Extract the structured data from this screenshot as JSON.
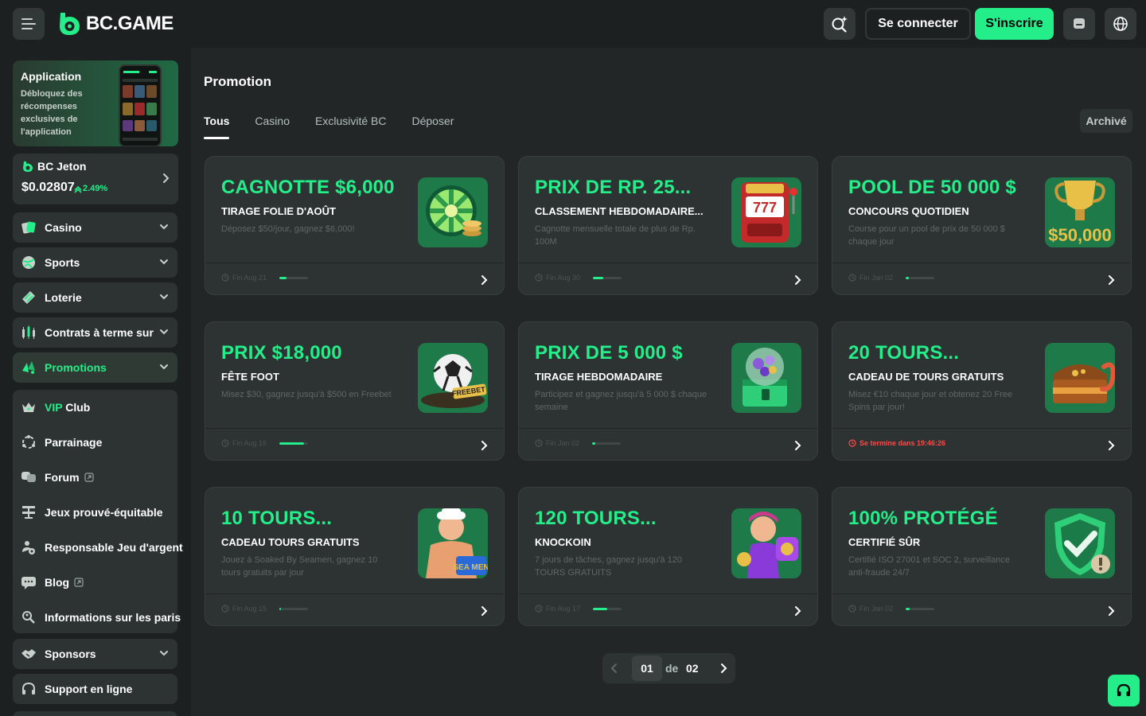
{
  "header": {
    "logo_text": "BC.GAME",
    "login_label": "Se connecter",
    "register_label": "S'inscrire",
    "accent_color": "#24ee89"
  },
  "sidebar": {
    "app_card": {
      "title": "Application",
      "description": "Débloquez des récompenses exclusives de l'application"
    },
    "jeton": {
      "label": "BC Jeton",
      "price": "$0.02807",
      "change": "2.49%"
    },
    "items": [
      {
        "label": "Casino",
        "icon": "casino-icon"
      },
      {
        "label": "Sports",
        "icon": "sports-icon"
      },
      {
        "label": "Loterie",
        "icon": "lottery-icon"
      },
      {
        "label": "Contrats à terme sur",
        "icon": "futures-icon"
      },
      {
        "label": "Promotions",
        "icon": "promotions-icon"
      }
    ],
    "group_items": [
      {
        "label_prefix": "VIP",
        "label": "Club",
        "icon": "vip-crown-icon"
      },
      {
        "label": "Parrainage",
        "icon": "referral-icon"
      },
      {
        "label": "Forum",
        "icon": "forum-icon"
      },
      {
        "label": "Jeux prouvé-équitable",
        "icon": "provably-fair-icon"
      },
      {
        "label": "Responsable Jeu d'argent",
        "icon": "responsible-gambling-icon"
      },
      {
        "label": "Blog",
        "icon": "blog-icon"
      },
      {
        "label": "Informations sur les paris",
        "icon": "bet-info-icon"
      }
    ],
    "sponsors_label": "Sponsors",
    "support_label": "Support en ligne"
  },
  "main": {
    "title": "Promotion",
    "tabs": [
      "Tous",
      "Casino",
      "Exclusivité BC",
      "Déposer"
    ],
    "archive_label": "Archivé",
    "promos": [
      {
        "title": "CAGNOTTE $6,000",
        "subtitle": "TIRAGE FOLIE D'AOÛT",
        "desc": "Déposez $50/jour, gagnez $6,000!",
        "footer": "Fin Aug 21",
        "progress": 0.25,
        "image": "jackpot-wheel"
      },
      {
        "title": "PRIX DE RP. 25...",
        "subtitle": "CLASSEMENT HEBDOMADAIRE...",
        "desc": "Cagnotte mensuelle totale de plus de Rp. 100M",
        "footer": "Fin Aug 30",
        "progress": 0.35,
        "image": "slot-machine"
      },
      {
        "title": "POOL DE 50 000 $",
        "subtitle": "CONCOURS QUOTIDIEN",
        "desc": "Course pour un pool de prix de 50 000 $ chaque jour",
        "footer": "Fin Jan 02",
        "progress": 0.1,
        "image": "trophy-50000"
      },
      {
        "title": "PRIX $18,000",
        "subtitle": "FÊTE FOOT",
        "desc": "Misez $30, gagnez jusqu'à $500 en Freebet",
        "footer": "Fin Aug 16",
        "progress": 0.85,
        "image": "football-freebet"
      },
      {
        "title": "PRIX DE 5 000 $",
        "subtitle": "TIRAGE HEBDOMADAIRE",
        "desc": "Participez et gagnez jusqu'à 5 000 $ chaque semaine",
        "footer": "Fin Jan 02",
        "progress": 0.1,
        "image": "lottery-balls"
      },
      {
        "title": "20 TOURS...",
        "subtitle": "CADEAU DE TOURS GRATUITS",
        "desc": "Misez €10 chaque jour et obtenez 20 Free Spins par jour!",
        "footer": "Se termine dans 19:46:26",
        "footer_red": true,
        "progress": null,
        "image": "treasure-chest"
      },
      {
        "title": "10 TOURS...",
        "subtitle": "CADEAU TOURS GRATUITS",
        "desc": "Jouez à Soaked By Seamen, gagnez 10 tours gratuits par jour",
        "footer": "Fin Aug 15",
        "progress": 0.05,
        "image": "sailor-character"
      },
      {
        "title": "120 TOURS...",
        "subtitle": "KNOCKOIN",
        "desc": "7 jours de tâches, gagnez jusqu'à 120 TOURS GRATUITS",
        "footer": "Fin Aug 17",
        "progress": 0.5,
        "image": "knockoin-character"
      },
      {
        "title": "100% PROTÉGÉ",
        "subtitle": "CERTIFIÉ SÛR",
        "desc": "Certifié ISO 27001 et SOC 2, surveillance anti-fraude 24/7",
        "footer": "Fin Jan 02",
        "progress": 0.15,
        "image": "shield-check"
      }
    ],
    "pagination": {
      "current": "01",
      "of_label": "de",
      "total": "02"
    }
  }
}
